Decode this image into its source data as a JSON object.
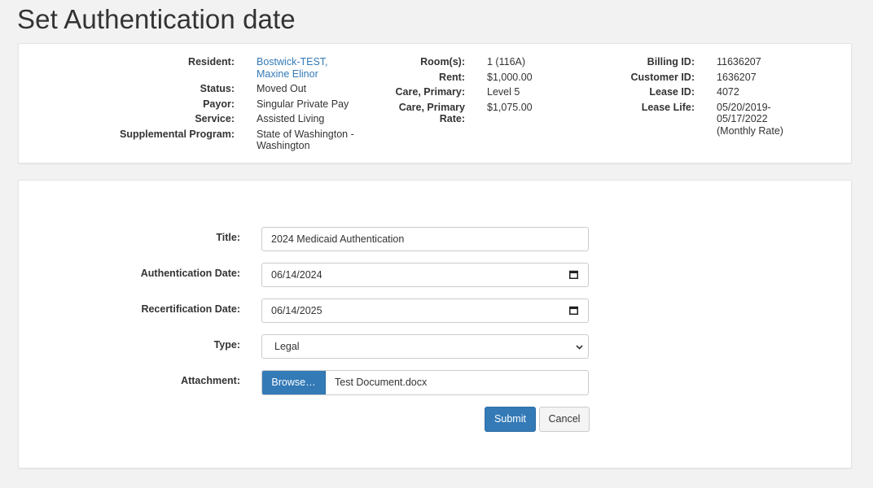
{
  "page": {
    "title": "Set Authentication date"
  },
  "resident_info": {
    "col1": [
      {
        "label": "Resident:",
        "value": "Bostwick-TEST, Maxine Elinor",
        "is_link": true
      },
      {
        "label": "Status:",
        "value": "Moved Out"
      },
      {
        "label": "Payor:",
        "value": "Singular Private Pay"
      },
      {
        "label": "Service:",
        "value": "Assisted Living"
      },
      {
        "label": "Supplemental Program:",
        "value": "State of Washington - Washington"
      }
    ],
    "col2": [
      {
        "label": "Room(s):",
        "value": "1 (116A)"
      },
      {
        "label": "Rent:",
        "value": "$1,000.00"
      },
      {
        "label": "Care, Primary:",
        "value": "Level 5"
      },
      {
        "label": "Care, Primary Rate:",
        "value": "$1,075.00"
      }
    ],
    "col3": [
      {
        "label": "Billing ID:",
        "value": "11636207"
      },
      {
        "label": "Customer ID:",
        "value": "1636207"
      },
      {
        "label": "Lease ID:",
        "value": "4072"
      },
      {
        "label": "Lease Life:",
        "value": "05/20/2019-05/17/2022 (Monthly Rate)"
      }
    ]
  },
  "form": {
    "title": {
      "label": "Title:",
      "value": "2024 Medicaid Authentication"
    },
    "auth_date": {
      "label": "Authentication Date:",
      "value": "06/14/2024"
    },
    "recert_date": {
      "label": "Recertification Date:",
      "value": "06/14/2025"
    },
    "type": {
      "label": "Type:",
      "value": "Legal"
    },
    "attachment": {
      "label": "Attachment:",
      "browse_label": "Browse…",
      "file_name": "Test Document.docx"
    },
    "submit_label": "Submit",
    "cancel_label": "Cancel"
  },
  "colors": {
    "primary": "#337ab7",
    "link": "#337ab7",
    "background": "#f2f2f2"
  },
  "icons": {
    "date_picker": "calendar-icon",
    "select": "chevron-down-icon"
  }
}
